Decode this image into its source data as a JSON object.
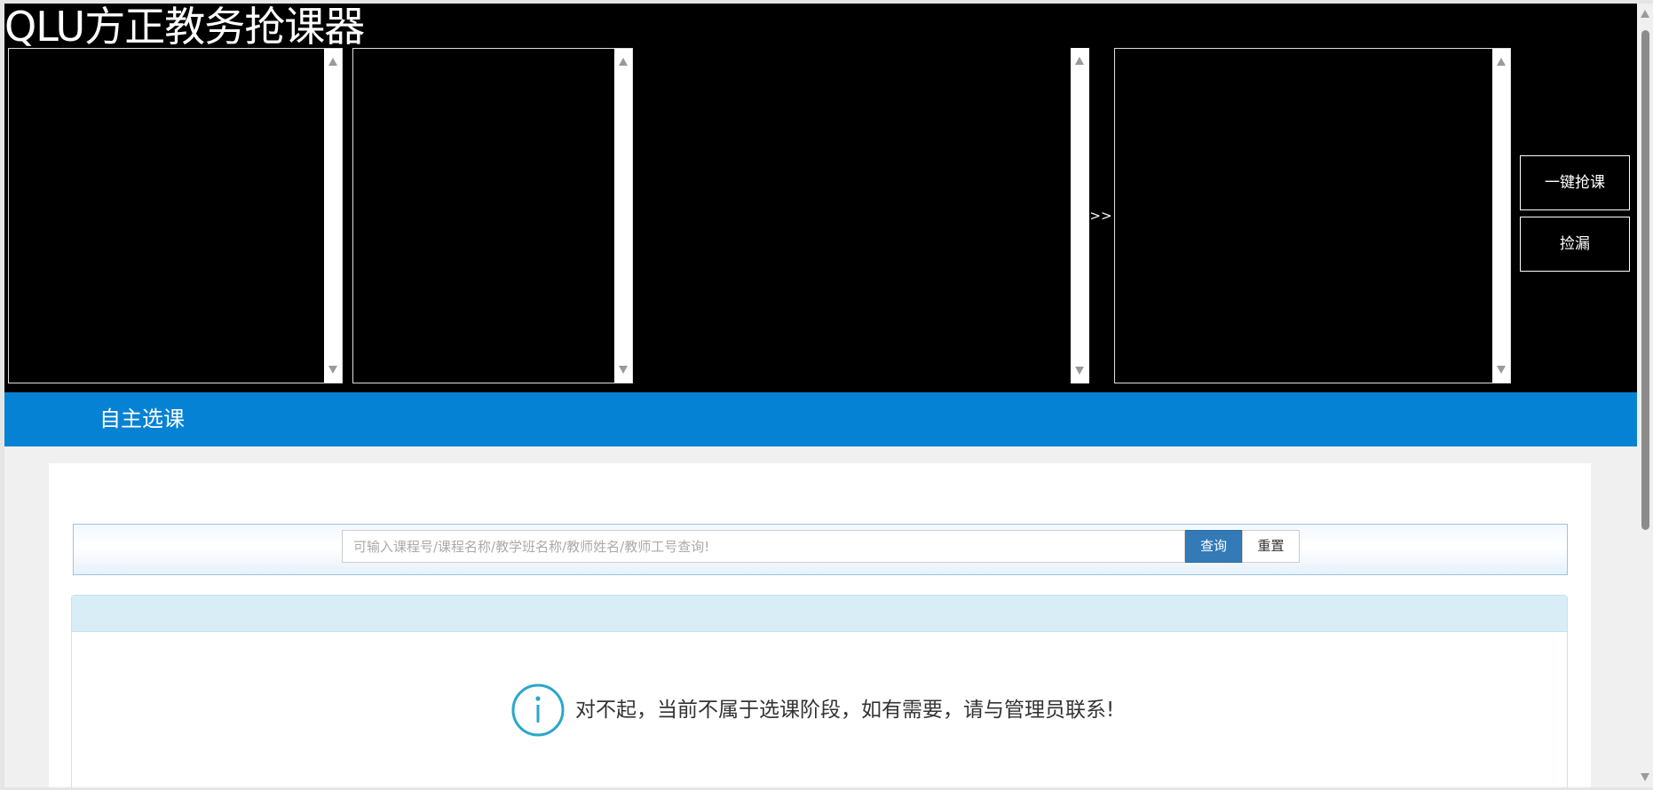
{
  "app": {
    "title": "QLU方正教务抢课器"
  },
  "toolbar": {
    "move_label": ">>",
    "grab_all_label": "一键抢课",
    "pick_missing_label": "捡漏"
  },
  "nav": {
    "section_title": "自主选课"
  },
  "search": {
    "placeholder": "可输入课程号/课程名称/教学班名称/教师姓名/教师工号查询!",
    "value": "",
    "query_label": "查询",
    "reset_label": "重置"
  },
  "notice": {
    "message": "对不起，当前不属于选课阶段，如有需要，请与管理员联系!"
  },
  "colors": {
    "band": "#0682d4",
    "primary_button": "#337ab7",
    "info_icon": "#2ba6cb"
  },
  "icons": [
    "scroll-up-arrow-icon",
    "scroll-down-arrow-icon",
    "info-icon"
  ]
}
